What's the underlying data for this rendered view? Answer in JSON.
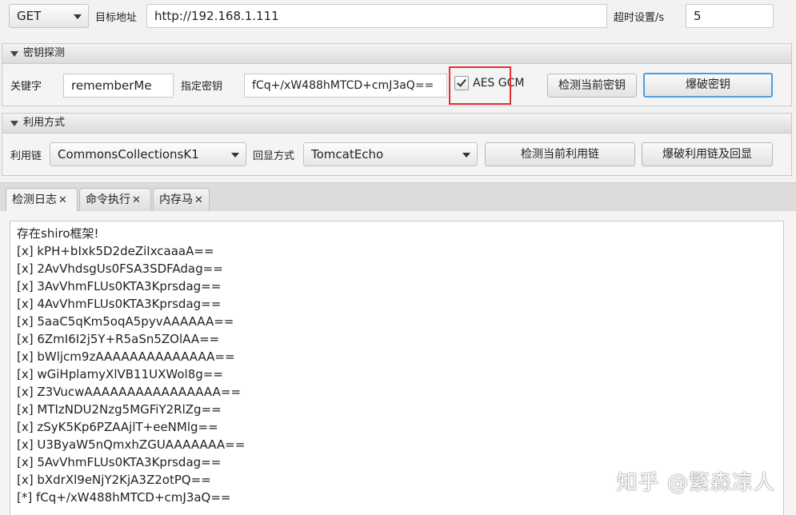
{
  "request": {
    "method": "GET",
    "target_label": "目标地址",
    "target_url": "http://192.168.1.111",
    "timeout_label": "超时设置/s",
    "timeout_value": "5"
  },
  "key_section": {
    "header": "密钥探测",
    "keyword_label": "关键字",
    "keyword_value": "rememberMe",
    "key_label": "指定密钥",
    "key_value": "fCq+/xW488hMTCD+cmJ3aQ==",
    "aes_gcm_label": "AES GCM",
    "aes_gcm_checked": true,
    "detect_key_button": "检测当前密钥",
    "brute_key_button": "爆破密钥"
  },
  "exploit_section": {
    "header": "利用方式",
    "chain_label": "利用链",
    "chain_value": "CommonsCollectionsK1",
    "echo_label": "回显方式",
    "echo_value": "TomcatEcho",
    "detect_chain_button": "检测当前利用链",
    "brute_chain_button": "爆破利用链及回显"
  },
  "tabs": [
    {
      "label": "检测日志",
      "close": "✕"
    },
    {
      "label": "命令执行",
      "close": "✕"
    },
    {
      "label": "内存马",
      "close": "✕"
    }
  ],
  "log_lines": [
    "存在shiro框架!",
    "[x] kPH+bIxk5D2deZiIxcaaaA==",
    "[x] 2AvVhdsgUs0FSA3SDFAdag==",
    "[x] 3AvVhmFLUs0KTA3Kprsdag==",
    "[x] 4AvVhmFLUs0KTA3Kprsdag==",
    "[x] 5aaC5qKm5oqA5pyvAAAAAA==",
    "[x] 6ZmI6I2j5Y+R5aSn5ZOlAA==",
    "[x] bWljcm9zAAAAAAAAAAAAAA==",
    "[x] wGiHplamyXlVB11UXWol8g==",
    "[x] Z3VucwAAAAAAAAAAAAAAAA==",
    "[x] MTIzNDU2Nzg5MGFiY2RlZg==",
    "[x] zSyK5Kp6PZAAjlT+eeNMlg==",
    "[x] U3ByaW5nQmxhZGUAAAAAAA==",
    "[x] 5AvVhmFLUs0KTA3Kprsdag==",
    "[x] bXdrXl9eNjY2KjA3Z2otPQ==",
    "[*] fCq+/xW488hMTCD+cmJ3aQ=="
  ],
  "watermark": "知乎 @繁森凉人",
  "colors": {
    "highlight_box": "#e03030",
    "focus_border": "#4d9ee0"
  }
}
